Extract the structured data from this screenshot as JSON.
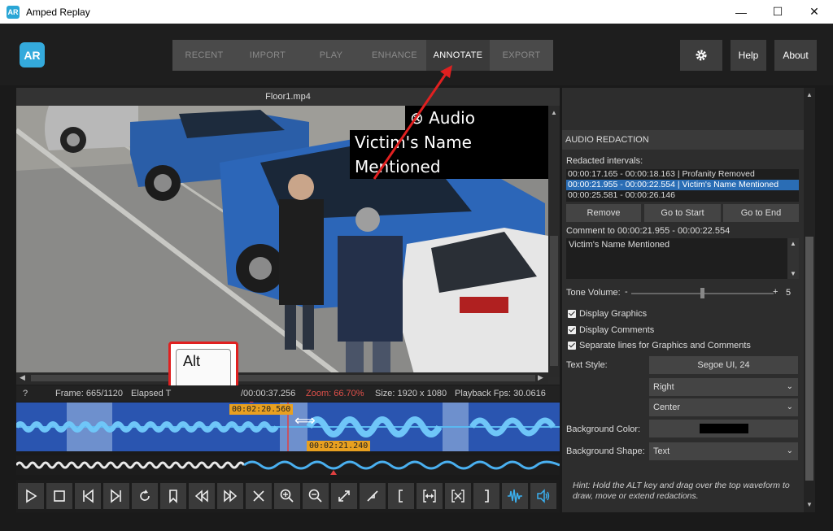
{
  "window": {
    "app_icon": "AR",
    "title": "Amped Replay",
    "minimize_icon": "—",
    "maximize_icon": "☐",
    "close_icon": "✕"
  },
  "logo": {
    "text": "AR"
  },
  "menu": {
    "items": [
      {
        "label": "RECENT"
      },
      {
        "label": "IMPORT"
      },
      {
        "label": "PLAY"
      },
      {
        "label": "ENHANCE"
      },
      {
        "label": "ANNOTATE"
      },
      {
        "label": "EXPORT"
      }
    ],
    "active": "ANNOTATE"
  },
  "top_buttons": {
    "settings_icon": "gear-icon",
    "help": "Help",
    "about": "About"
  },
  "video": {
    "filename": "Floor1.mp4",
    "overlay_line1": "Audio Redacted",
    "overlay_line2": "Victim's Name Mentioned",
    "alt_key": "Alt"
  },
  "info": {
    "help": "?",
    "frame": "Frame: 665/1120",
    "elapsed": "Elapsed T",
    "duration": "/00:00:37.256",
    "zoom": "Zoom: 66.70%",
    "size": "Size: 1920 x 1080",
    "fps": "Playback Fps: 30.0616"
  },
  "waveform": {
    "tag_start": "00:02:20.560",
    "tag_end": "00:02:21.240"
  },
  "audio_redaction": {
    "header": "AUDIO REDACTION",
    "intervals_label": "Redacted intervals:",
    "intervals": [
      {
        "text": "00:00:17.165 - 00:00:18.163  |  Profanity Removed",
        "selected": false
      },
      {
        "text": "00:00:21.955 - 00:00:22.554  |  Victim's Name Mentioned",
        "selected": true
      },
      {
        "text": "00:00:25.581 - 00:00:26.146",
        "selected": false
      }
    ],
    "remove_button": "Remove",
    "go_start_button": "Go to Start",
    "go_end_button": "Go to End",
    "comment_label": "Comment to 00:00:21.955 - 00:00:22.554",
    "comment_value": "Victim's Name Mentioned",
    "tone_label": "Tone Volume:",
    "tone_minus": "-",
    "tone_plus": "+",
    "tone_value": "5",
    "display_graphics": "Display Graphics",
    "display_comments": "Display Comments",
    "separate_lines": "Separate lines for Graphics and Comments",
    "text_style_label": "Text Style:",
    "text_style_value": "Segoe UI, 24",
    "align_h": "Right",
    "align_v": "Center",
    "bg_color_label": "Background Color:",
    "bg_color_value": "#000000",
    "bg_shape_label": "Background Shape:",
    "bg_shape_value": "Text",
    "hint": "Hint: Hold the ALT key and drag over the top waveform to draw, move or extend redactions."
  }
}
